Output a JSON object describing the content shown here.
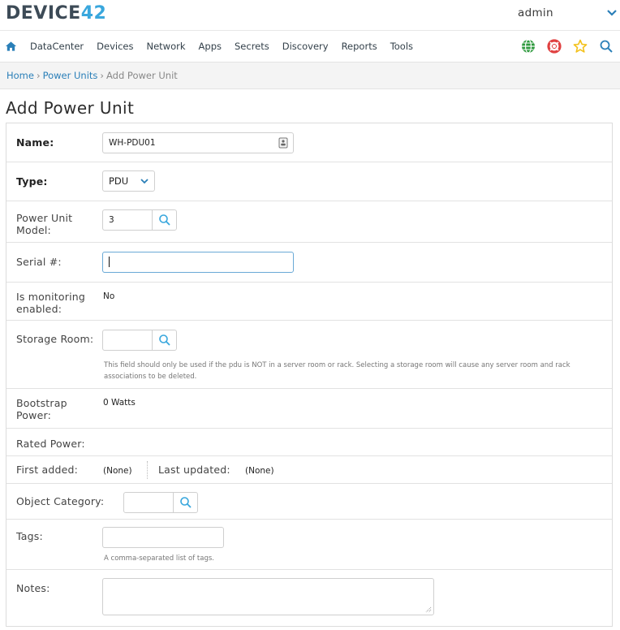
{
  "header": {
    "logo_main": "DEVICE",
    "logo_accent": "42",
    "username": "admin",
    "user_menu_icon": "chevron-down-icon"
  },
  "nav": {
    "home_icon": "home-icon",
    "items": [
      {
        "label": "DataCenter"
      },
      {
        "label": "Devices"
      },
      {
        "label": "Network"
      },
      {
        "label": "Apps"
      },
      {
        "label": "Secrets"
      },
      {
        "label": "Discovery"
      },
      {
        "label": "Reports"
      },
      {
        "label": "Tools"
      }
    ],
    "right_icons": [
      "globe-icon",
      "lifebuoy-icon",
      "star-icon",
      "search-icon"
    ]
  },
  "breadcrumb": {
    "home": "Home",
    "section": "Power Units",
    "current": "Add Power Unit",
    "separator": "›"
  },
  "page": {
    "title": "Add Power Unit"
  },
  "form": {
    "name": {
      "label": "Name:",
      "value": "WH-PDU01"
    },
    "type": {
      "label": "Type:",
      "value": "PDU"
    },
    "model": {
      "label": "Power Unit Model:",
      "value": "3"
    },
    "serial": {
      "label": "Serial #:",
      "value": ""
    },
    "monitoring": {
      "label": "Is monitoring enabled:",
      "value": "No"
    },
    "storage": {
      "label": "Storage Room:",
      "value": "",
      "help": "This field should only be used if the pdu is NOT in a server room or rack. Selecting a storage room will cause any server room and rack associations to be deleted."
    },
    "bootstrap": {
      "label": "Bootstrap Power:",
      "value": "0 Watts"
    },
    "rated": {
      "label": "Rated Power:",
      "value": ""
    },
    "first_added": {
      "label": "First added:",
      "value": "(None)"
    },
    "last_updated": {
      "label": "Last updated:",
      "value": "(None)"
    },
    "category": {
      "label": "Object Category:",
      "value": ""
    },
    "tags": {
      "label": "Tags:",
      "value": "",
      "help": "A comma-separated list of tags."
    },
    "notes": {
      "label": "Notes:",
      "value": ""
    }
  },
  "colors": {
    "accent": "#39a7dd",
    "link": "#2a7fb8",
    "brand_dark": "#3d4b57",
    "globe": "#2e9a3e",
    "lifebuoy": "#e04040",
    "star": "#f3c11b"
  }
}
